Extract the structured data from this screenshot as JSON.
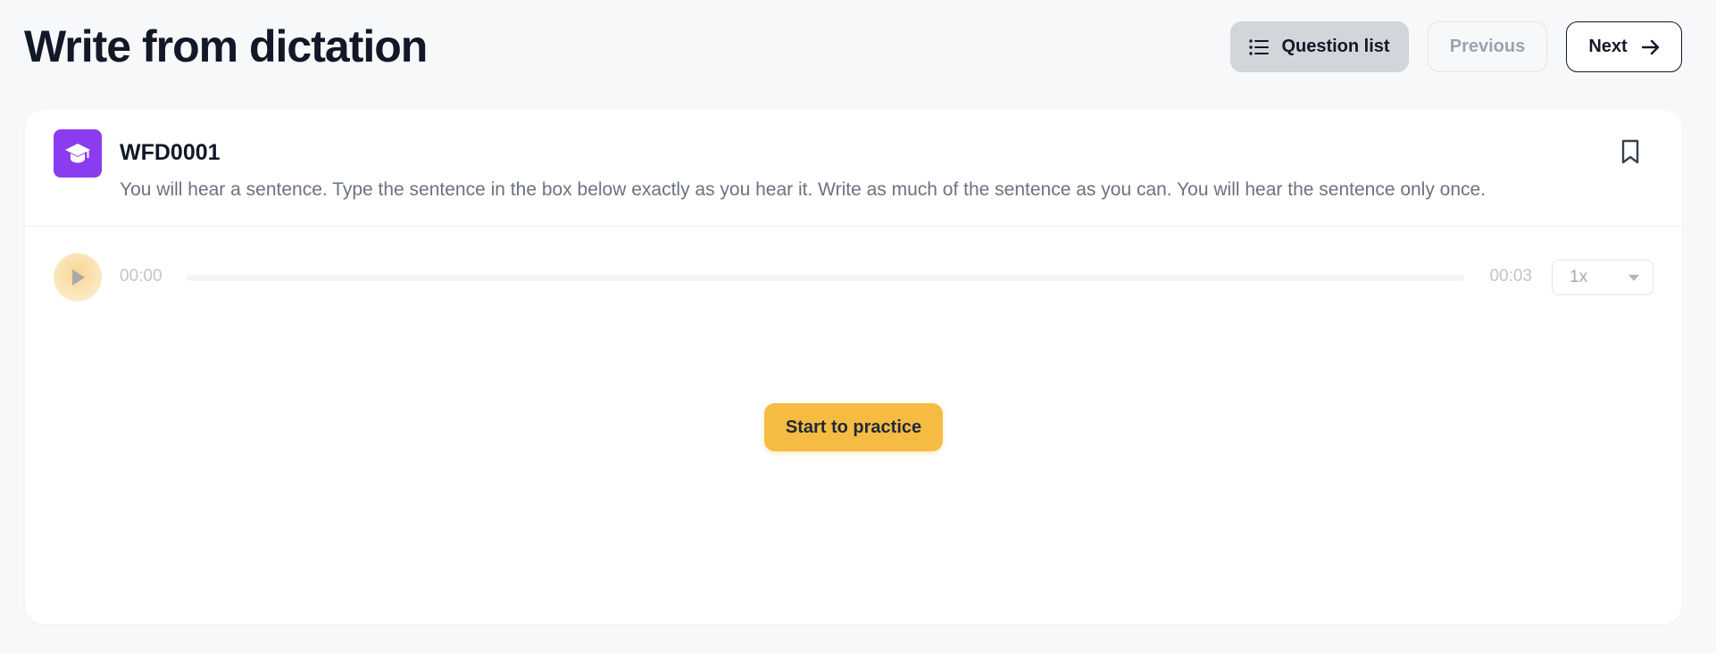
{
  "page": {
    "title": "Write from dictation"
  },
  "toolbar": {
    "question_list_label": "Question list",
    "previous_label": "Previous",
    "next_label": "Next"
  },
  "question": {
    "id": "WFD0001",
    "instructions": "You will hear a sentence. Type the sentence in the box below exactly as you hear it. Write as much of the sentence as you can. You will hear the sentence only once."
  },
  "player": {
    "current_time": "00:00",
    "duration": "00:03",
    "progress": 0,
    "speed": "1x"
  },
  "actions": {
    "start_label": "Start to practice"
  },
  "colors": {
    "accent": "#f6bb42",
    "question_icon_bg": "#8b3cf0",
    "title": "#111827",
    "muted_text": "#6b7280"
  },
  "icons": {
    "question_list": "list-icon",
    "next": "arrow-right-icon",
    "question": "graduation-cap-icon",
    "bookmark": "bookmark-icon",
    "play": "play-icon",
    "dropdown": "chevron-down-icon"
  }
}
